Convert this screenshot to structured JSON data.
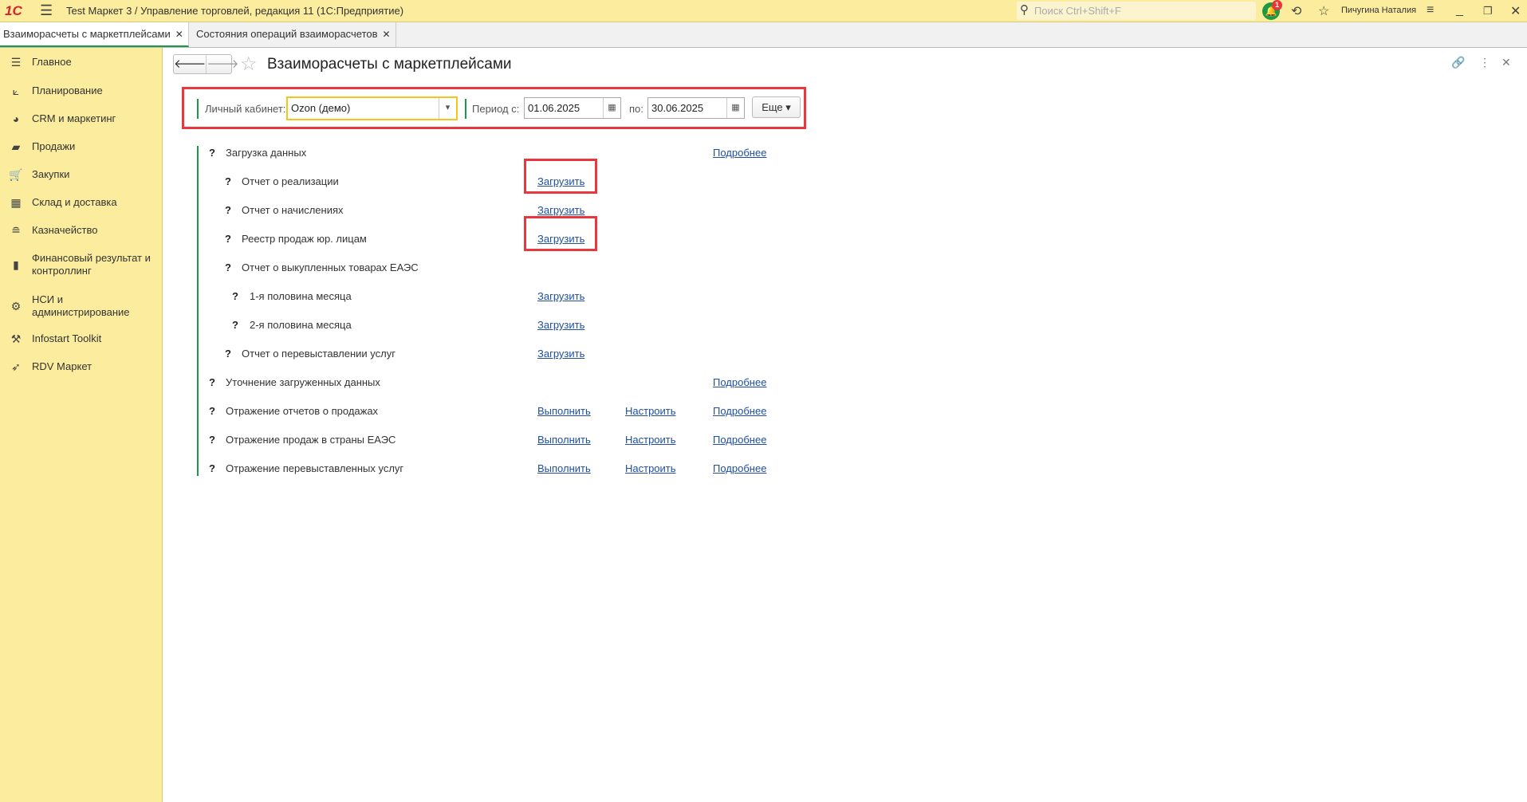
{
  "titlebar": {
    "logo": "1С",
    "title": "Test Маркет 3 / Управление торговлей, редакция 11  (1С:Предприятие)",
    "search_placeholder": "Поиск Ctrl+Shift+F",
    "notifications": "1",
    "user": "Пичугина Наталия"
  },
  "tabs": [
    {
      "label": "Взаиморасчеты с маркетплейсами",
      "active": true
    },
    {
      "label": "Состояния операций взаиморасчетов",
      "active": false
    }
  ],
  "sidebar": [
    {
      "icon": "list-icon",
      "label": "Главное"
    },
    {
      "icon": "planning-icon",
      "label": "Планирование"
    },
    {
      "icon": "pie-chart-icon",
      "label": "CRM и маркетинг"
    },
    {
      "icon": "bag-icon",
      "label": "Продажи"
    },
    {
      "icon": "cart-icon",
      "label": "Закупки"
    },
    {
      "icon": "warehouse-icon",
      "label": "Склад и доставка"
    },
    {
      "icon": "coins-icon",
      "label": "Казначейство"
    },
    {
      "icon": "bar-chart-icon",
      "label": "Финансовый результат и контроллинг"
    },
    {
      "icon": "gear-icon",
      "label": "НСИ и администрирование"
    },
    {
      "icon": "tools-icon",
      "label": "Infostart Toolkit"
    },
    {
      "icon": "rocket-icon",
      "label": "RDV Маркет"
    }
  ],
  "page": {
    "title": "Взаиморасчеты с маркетплейсами"
  },
  "filter": {
    "cabinet_label": "Личный кабинет:",
    "cabinet_value": "Ozon (демо)",
    "period_label": "Период с:",
    "date_from": "01.06.2025",
    "to_label": "по:",
    "date_to": "30.06.2025",
    "more_label": "Еще"
  },
  "rows": [
    {
      "q": "?",
      "label": "Загрузка данных",
      "level": 0,
      "links": [
        "",
        "",
        "Подробнее"
      ]
    },
    {
      "q": "?",
      "label": "Отчет о реализации",
      "level": 1,
      "links": [
        "Загрузить",
        "",
        ""
      ],
      "highlight": true
    },
    {
      "q": "?",
      "label": "Отчет о начислениях",
      "level": 1,
      "links": [
        "Загрузить",
        "",
        ""
      ]
    },
    {
      "q": "?",
      "label": "Реестр продаж юр. лицам",
      "level": 1,
      "links": [
        "Загрузить",
        "",
        ""
      ],
      "highlight": true
    },
    {
      "q": "?",
      "label": "Отчет о выкупленных товарах ЕАЭС",
      "level": 1,
      "links": [
        "",
        "",
        ""
      ]
    },
    {
      "q": "?",
      "label": "1-я половина месяца",
      "level": 2,
      "links": [
        "Загрузить",
        "",
        ""
      ]
    },
    {
      "q": "?",
      "label": "2-я половина месяца",
      "level": 2,
      "links": [
        "Загрузить",
        "",
        ""
      ]
    },
    {
      "q": "?",
      "label": "Отчет о перевыставлении услуг",
      "level": 1,
      "links": [
        "Загрузить",
        "",
        ""
      ]
    },
    {
      "q": "?",
      "label": "Уточнение загруженных данных",
      "level": 0,
      "links": [
        "",
        "",
        "Подробнее"
      ]
    },
    {
      "q": "?",
      "label": "Отражение отчетов о продажах",
      "level": 0,
      "links": [
        "Выполнить",
        "Настроить",
        "Подробнее"
      ]
    },
    {
      "q": "?",
      "label": "Отражение продаж в страны ЕАЭС",
      "level": 0,
      "links": [
        "Выполнить",
        "Настроить",
        "Подробнее"
      ]
    },
    {
      "q": "?",
      "label": "Отражение перевыставленных услуг",
      "level": 0,
      "links": [
        "Выполнить",
        "Настроить",
        "Подробнее"
      ]
    }
  ]
}
